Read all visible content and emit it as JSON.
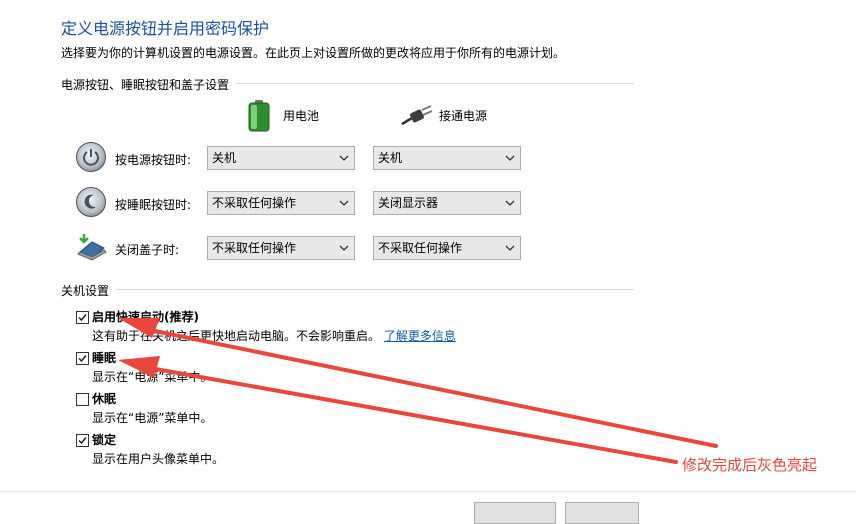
{
  "page": {
    "title": "定义电源按钮并启用密码保护",
    "description": "选择要为你的计算机设置的电源设置。在此页上对设置所做的更改将应用于你所有的电源计划。"
  },
  "power_section": {
    "heading": "电源按钮、睡眠按钮和盖子设置",
    "columns": {
      "battery": "用电池",
      "plugged_in": "接通电源"
    },
    "rows": [
      {
        "label": "按电源按钮时:",
        "battery": "关机",
        "plugged_in": "关机",
        "icon": "power-button-icon"
      },
      {
        "label": "按睡眠按钮时:",
        "battery": "不采取任何操作",
        "plugged_in": "关闭显示器",
        "icon": "sleep-button-icon"
      },
      {
        "label": "关闭盖子时:",
        "battery": "不采取任何操作",
        "plugged_in": "不采取任何操作",
        "icon": "laptop-lid-icon"
      }
    ]
  },
  "shutdown_section": {
    "heading": "关机设置",
    "options": [
      {
        "label": "启用快速启动(推荐)",
        "checked": true,
        "description": "这有助于在关机之后更快地启动电脑。不会影响重启。",
        "link": "了解更多信息"
      },
      {
        "label": "睡眠",
        "checked": true,
        "description": "显示在“电源”菜单中。"
      },
      {
        "label": "休眠",
        "checked": false,
        "description": "显示在“电源”菜单中。"
      },
      {
        "label": "锁定",
        "checked": true,
        "description": "显示在用户头像菜单中。"
      }
    ]
  },
  "annotation": {
    "text": "修改完成后灰色亮起",
    "color": "#e8473b"
  },
  "colors": {
    "title": "#1e4fa0",
    "link": "#0b5cad",
    "dropdown_bg": "#e8e8e8"
  }
}
